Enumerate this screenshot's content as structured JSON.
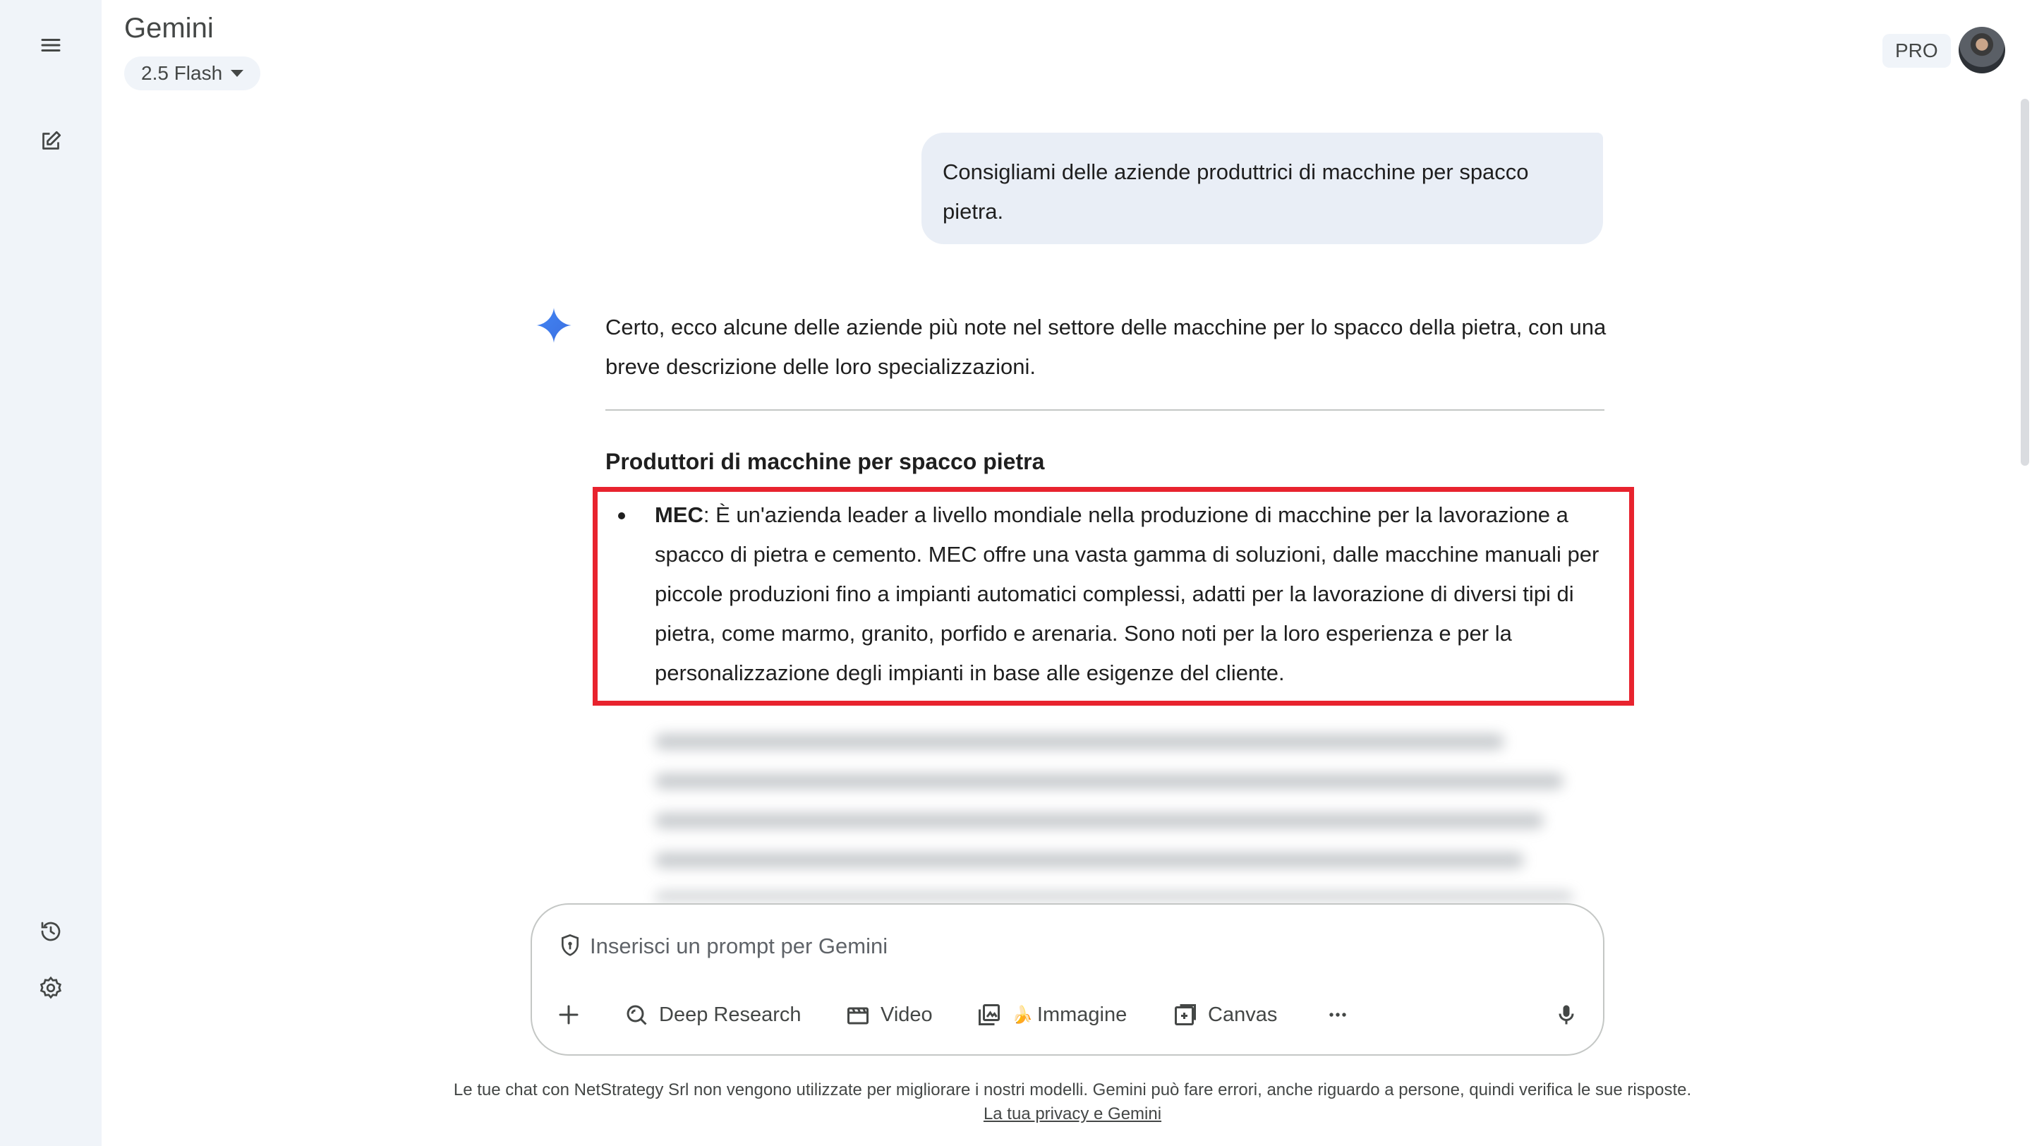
{
  "app": {
    "title": "Gemini",
    "model": "2.5 Flash"
  },
  "header": {
    "plan_badge": "PRO"
  },
  "sidebar": {
    "menu_icon": "menu-icon",
    "new_chat_icon": "edit-square-icon",
    "activity_icon": "history-icon",
    "settings_icon": "gear-icon"
  },
  "chat": {
    "user_message": "Consigliami delle aziende produttrici di macchine per spacco pietra.",
    "response_intro": "Certo, ecco alcune delle aziende più note nel settore delle macchine per lo spacco della pietra, con una breve descrizione delle loro specializzazioni.",
    "section_title": "Produttori di macchine per spacco pietra",
    "items": [
      {
        "name": "MEC",
        "text": ": È un'azienda leader a livello mondiale nella produzione di macchine per la lavorazione a spacco di pietra e cemento. MEC offre una vasta gamma di soluzioni, dalle macchine manuali per piccole produzioni fino a impianti automatici complessi, adatti per la lavorazione di diversi tipi di pietra, come marmo, granito, porfido e arenaria. Sono noti per la loro esperienza e per la personalizzazione degli impianti in base alle esigenze del cliente."
      }
    ],
    "highlight_color": "#e8232e"
  },
  "composer": {
    "placeholder": "Inserisci un prompt per Gemini",
    "tools": [
      {
        "label": "Deep Research",
        "icon": "deep-research-icon"
      },
      {
        "label": "Video",
        "icon": "video-icon"
      },
      {
        "label": "Immagine",
        "icon": "image-icon",
        "emoji": "🍌"
      },
      {
        "label": "Canvas",
        "icon": "canvas-icon"
      }
    ],
    "more_icon": "more-horiz-icon",
    "mic_icon": "mic-icon",
    "add_icon": "plus-icon"
  },
  "footer": {
    "disclaimer": "Le tue chat con NetStrategy Srl non vengono utilizzate per migliorare i nostri modelli. Gemini può fare errori, anche riguardo a persone, quindi verifica le sue risposte. ",
    "privacy_link": "La tua privacy e Gemini"
  },
  "colors": {
    "rail_bg": "#f0f4f9",
    "bubble_bg": "#e9eef6",
    "accent_blue": "#4285f4"
  }
}
